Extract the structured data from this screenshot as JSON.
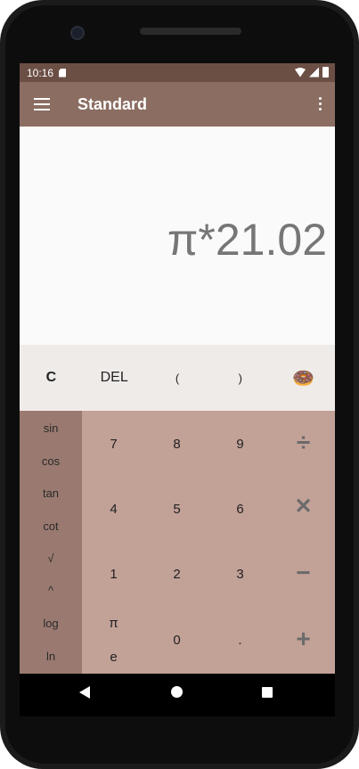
{
  "status_bar": {
    "time": "10:16",
    "icons": [
      "sd-card-icon",
      "wifi-icon",
      "signal-icon",
      "battery-icon"
    ]
  },
  "app_bar": {
    "title": "Standard",
    "menu_icon": "hamburger-menu-icon",
    "overflow_icon": "more-vert-icon",
    "color": "#8b6d62"
  },
  "display": {
    "expression": "π*21.02"
  },
  "top_row": {
    "clear": "C",
    "delete": "DEL",
    "open_paren": "(",
    "close_paren": ")",
    "donut": "🍩"
  },
  "scientific": {
    "sin": "sin",
    "cos": "cos",
    "tan": "tan",
    "cot": "cot",
    "sqrt": "√",
    "power": "^",
    "log": "log",
    "ln": "ln"
  },
  "keypad": {
    "seven": "7",
    "eight": "8",
    "nine": "9",
    "four": "4",
    "five": "5",
    "six": "6",
    "one": "1",
    "two": "2",
    "three": "3",
    "pi": "π",
    "e": "e",
    "zero": "0",
    "dot": ".",
    "divide": "÷",
    "multiply": "✕",
    "minus": "−",
    "plus": "+"
  },
  "colors": {
    "status_bar": "#6b4f45",
    "app_bar": "#8b6d62",
    "top_row": "#efebe9",
    "scientific_panel": "#9a7a70",
    "keypad": "#c2a197"
  }
}
